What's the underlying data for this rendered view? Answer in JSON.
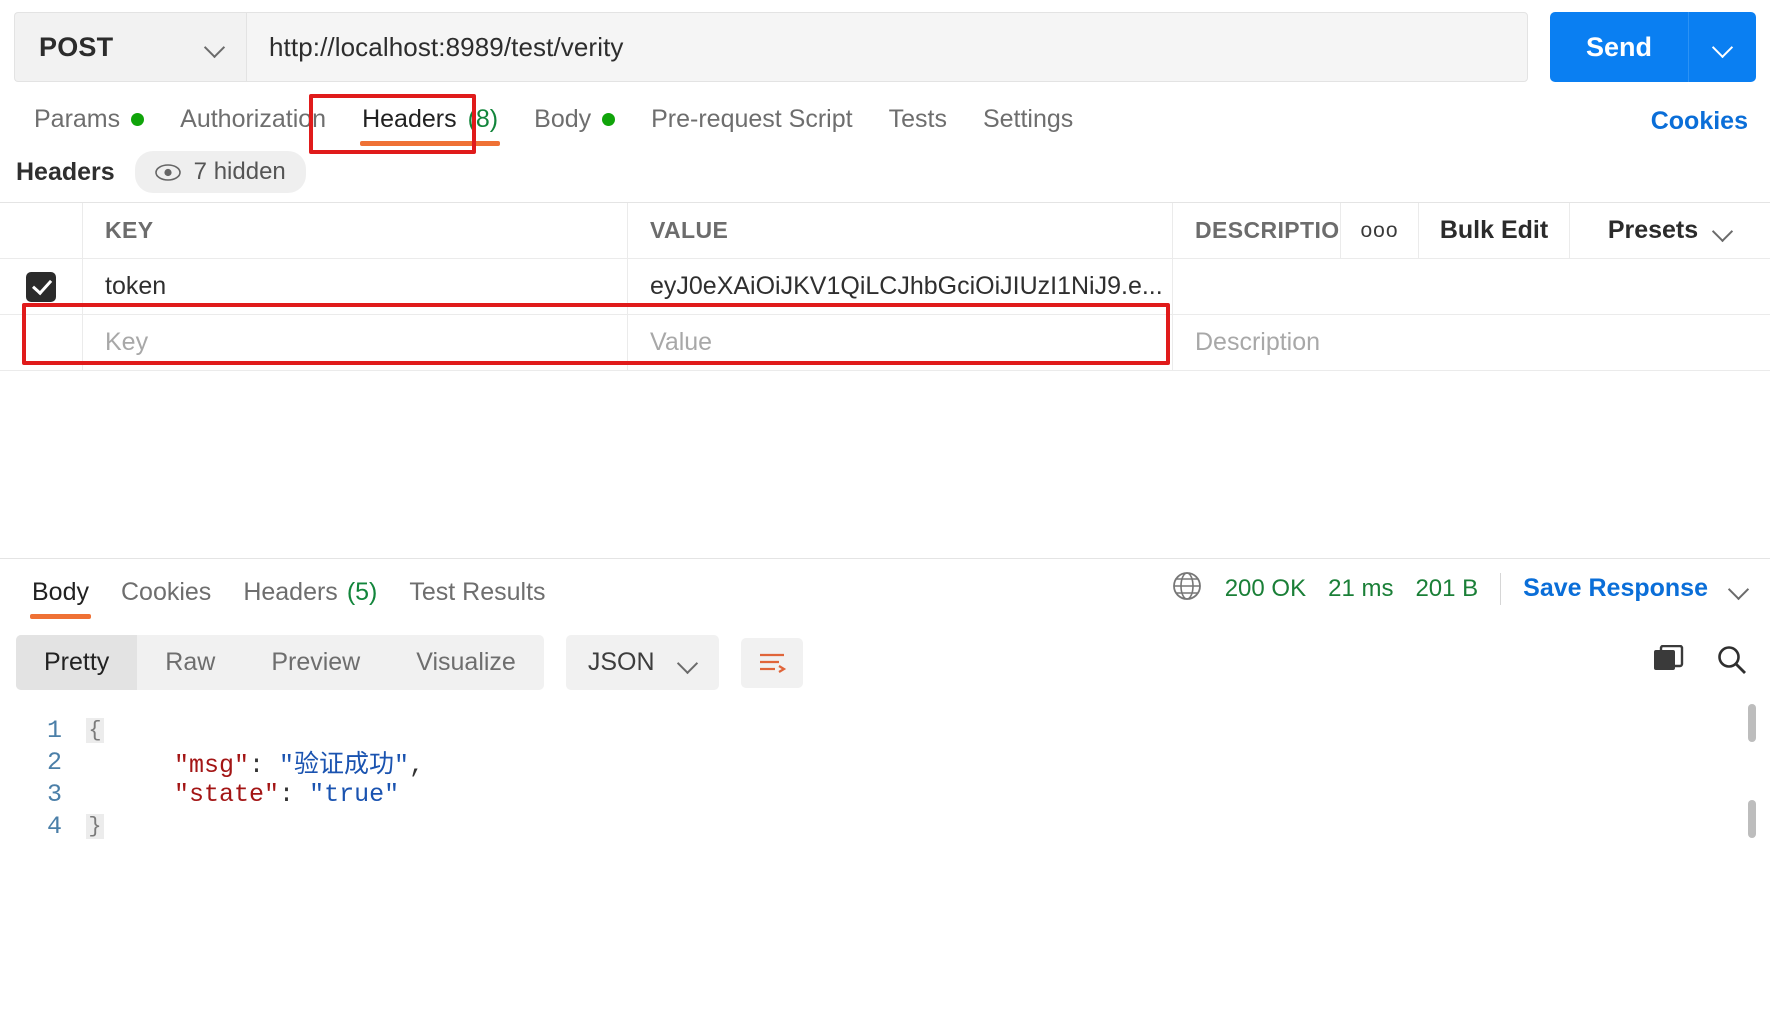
{
  "request": {
    "method": "POST",
    "url": "http://localhost:8989/test/verity",
    "send_label": "Send",
    "tabs": [
      {
        "label": "Params",
        "dot": true,
        "count": "",
        "active": false
      },
      {
        "label": "Authorization",
        "dot": false,
        "count": "",
        "active": false
      },
      {
        "label": "Headers",
        "dot": false,
        "count": "(8)",
        "active": true
      },
      {
        "label": "Body",
        "dot": true,
        "count": "",
        "active": false
      },
      {
        "label": "Pre-request Script",
        "dot": false,
        "count": "",
        "active": false
      },
      {
        "label": "Tests",
        "dot": false,
        "count": "",
        "active": false
      },
      {
        "label": "Settings",
        "dot": false,
        "count": "",
        "active": false
      }
    ],
    "cookies_label": "Cookies"
  },
  "headers_panel": {
    "title": "Headers",
    "hidden_badge": "7 hidden",
    "columns": {
      "key": "KEY",
      "value": "VALUE",
      "description": "DESCRIPTIO"
    },
    "toolbar": {
      "dots": "ooo",
      "bulk_edit": "Bulk Edit",
      "presets": "Presets"
    },
    "rows": [
      {
        "checked": true,
        "key": "token",
        "value": "eyJ0eXAiOiJKV1QiLCJhbGciOiJIUzI1NiJ9.e...",
        "description": ""
      }
    ],
    "placeholders": {
      "key": "Key",
      "value": "Value",
      "description": "Description"
    }
  },
  "response": {
    "tabs": [
      {
        "label": "Body",
        "count": "",
        "active": true
      },
      {
        "label": "Cookies",
        "count": "",
        "active": false
      },
      {
        "label": "Headers",
        "count": "(5)",
        "active": false
      },
      {
        "label": "Test Results",
        "count": "",
        "active": false
      }
    ],
    "status": "200 OK",
    "time": "21 ms",
    "size": "201 B",
    "save_label": "Save Response",
    "view_modes": [
      "Pretty",
      "Raw",
      "Preview",
      "Visualize"
    ],
    "active_view": "Pretty",
    "format": "JSON",
    "body_lines": [
      {
        "n": "1",
        "fold": "{",
        "segments": [
          {
            "t": "{",
            "c": "p"
          }
        ],
        "indent": 0,
        "hide_text": true
      },
      {
        "n": "2",
        "fold": "",
        "segments": [
          {
            "t": "\"msg\"",
            "c": "k"
          },
          {
            "t": ": ",
            "c": "p"
          },
          {
            "t": "\"验证成功\"",
            "c": "v"
          },
          {
            "t": ",",
            "c": "p"
          }
        ],
        "indent": 1
      },
      {
        "n": "3",
        "fold": "",
        "segments": [
          {
            "t": "\"state\"",
            "c": "k"
          },
          {
            "t": ": ",
            "c": "p"
          },
          {
            "t": "\"true\"",
            "c": "v"
          }
        ],
        "indent": 1
      },
      {
        "n": "4",
        "fold": "}",
        "segments": [
          {
            "t": "}",
            "c": "p"
          }
        ],
        "indent": 0,
        "hide_text": true
      }
    ]
  },
  "colors": {
    "accent_orange": "#ef7135",
    "blue": "#0a7ff2",
    "link_blue": "#0a6ed8",
    "green": "#10a40a",
    "status_green": "#1a7f37",
    "highlight_red": "#e01b1b"
  }
}
